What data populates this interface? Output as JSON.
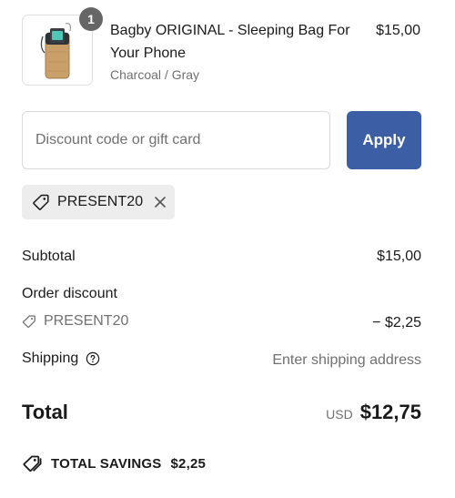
{
  "line_item": {
    "quantity": "1",
    "name": "Bagby ORIGINAL - Sleeping Bag For Your Phone",
    "variant": "Charcoal / Gray",
    "price": "$15,00",
    "image_icon": "phone-sleeping-bag-image"
  },
  "discount_form": {
    "placeholder": "Discount code or gift card",
    "value": "",
    "apply_label": "Apply",
    "apply_color": "#3b5ea5"
  },
  "applied_code": {
    "code": "PRESENT20",
    "tag_icon": "tag-icon",
    "remove_icon": "close-icon"
  },
  "summary": {
    "subtotal_label": "Subtotal",
    "subtotal_value": "$15,00",
    "order_discount_label": "Order discount",
    "discount_code": "PRESENT20",
    "discount_value": "− $2,25",
    "shipping_label": "Shipping",
    "shipping_value": "Enter shipping address",
    "total_label": "Total",
    "currency": "USD",
    "total_value": "$12,75",
    "savings_label": "TOTAL SAVINGS",
    "savings_value": "$2,25"
  }
}
